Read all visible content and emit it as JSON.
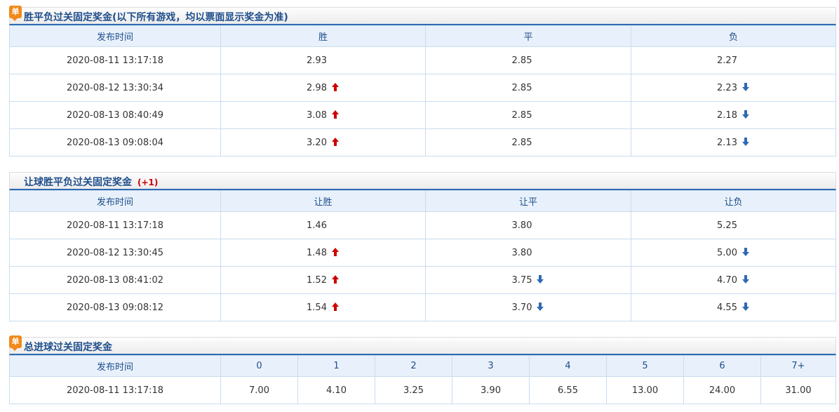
{
  "colors": {
    "up": "#cc0000",
    "down": "#2f69b3",
    "header_text": "#1f4e8c",
    "badge": "#f08a1c"
  },
  "section1": {
    "badge_icon": "单",
    "title": "胜平负过关固定奖金(以下所有游戏，均以票面显示奖金为准)",
    "columns": [
      "发布时间",
      "胜",
      "平",
      "负"
    ],
    "rows": [
      {
        "time": "2020-08-11 13:17:18",
        "win": "2.93",
        "win_dir": "none",
        "draw": "2.85",
        "draw_dir": "none",
        "lose": "2.27",
        "lose_dir": "none"
      },
      {
        "time": "2020-08-12 13:30:34",
        "win": "2.98",
        "win_dir": "up",
        "draw": "2.85",
        "draw_dir": "none",
        "lose": "2.23",
        "lose_dir": "down"
      },
      {
        "time": "2020-08-13 08:40:49",
        "win": "3.08",
        "win_dir": "up",
        "draw": "2.85",
        "draw_dir": "none",
        "lose": "2.18",
        "lose_dir": "down"
      },
      {
        "time": "2020-08-13 09:08:04",
        "win": "3.20",
        "win_dir": "up",
        "draw": "2.85",
        "draw_dir": "none",
        "lose": "2.13",
        "lose_dir": "down"
      }
    ]
  },
  "section2": {
    "title": "让球胜平负过关固定奖金",
    "handicap": "(+1)",
    "columns": [
      "发布时间",
      "让胜",
      "让平",
      "让负"
    ],
    "rows": [
      {
        "time": "2020-08-11 13:17:18",
        "win": "1.46",
        "win_dir": "none",
        "draw": "3.80",
        "draw_dir": "none",
        "lose": "5.25",
        "lose_dir": "none"
      },
      {
        "time": "2020-08-12 13:30:45",
        "win": "1.48",
        "win_dir": "up",
        "draw": "3.80",
        "draw_dir": "none",
        "lose": "5.00",
        "lose_dir": "down"
      },
      {
        "time": "2020-08-13 08:41:02",
        "win": "1.52",
        "win_dir": "up",
        "draw": "3.75",
        "draw_dir": "down",
        "lose": "4.70",
        "lose_dir": "down"
      },
      {
        "time": "2020-08-13 09:08:12",
        "win": "1.54",
        "win_dir": "up",
        "draw": "3.70",
        "draw_dir": "down",
        "lose": "4.55",
        "lose_dir": "down"
      }
    ]
  },
  "section3": {
    "badge_icon": "单",
    "title": "总进球过关固定奖金",
    "columns": [
      "发布时间",
      "0",
      "1",
      "2",
      "3",
      "4",
      "5",
      "6",
      "7+"
    ],
    "rows": [
      {
        "time": "2020-08-11 13:17:18",
        "values": [
          "7.00",
          "4.10",
          "3.25",
          "3.90",
          "6.55",
          "13.00",
          "24.00",
          "31.00"
        ]
      }
    ]
  }
}
